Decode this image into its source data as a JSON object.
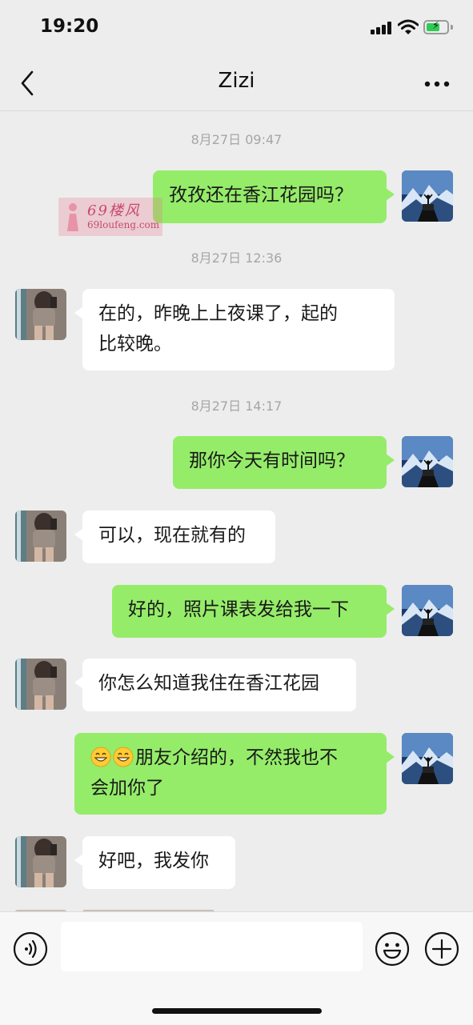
{
  "status_bar": {
    "time": "19:20"
  },
  "header": {
    "title": "Zizi"
  },
  "watermark": {
    "title": "69楼风",
    "url": "69loufeng.com"
  },
  "messages": [
    {
      "type": "time",
      "text": "8月27日 09:47"
    },
    {
      "type": "out",
      "lines": [
        "孜孜还在香江花园吗？"
      ]
    },
    {
      "type": "time",
      "text": "8月27日 12:36"
    },
    {
      "type": "in",
      "lines": [
        "在的，昨晚上上夜课了，起的",
        "比较晚。"
      ]
    },
    {
      "type": "time",
      "text": "8月27日 14:17"
    },
    {
      "type": "out",
      "lines": [
        "那你今天有时间吗？"
      ]
    },
    {
      "type": "in",
      "lines": [
        "可以，现在就有的"
      ]
    },
    {
      "type": "out",
      "lines": [
        "好的，照片课表发给我一下"
      ]
    },
    {
      "type": "in",
      "lines": [
        "你怎么知道我住在香江花园"
      ]
    },
    {
      "type": "out",
      "emoji": "grinning-face",
      "lines": [
        "朋友介绍的，不然我也不",
        "会加你了"
      ]
    },
    {
      "type": "in",
      "lines": [
        "好吧，我发你"
      ]
    }
  ],
  "input": {
    "value": "",
    "placeholder": ""
  },
  "colors": {
    "outgoing_bubble": "#95ec69",
    "incoming_bubble": "#ffffff",
    "background": "#ededed"
  }
}
